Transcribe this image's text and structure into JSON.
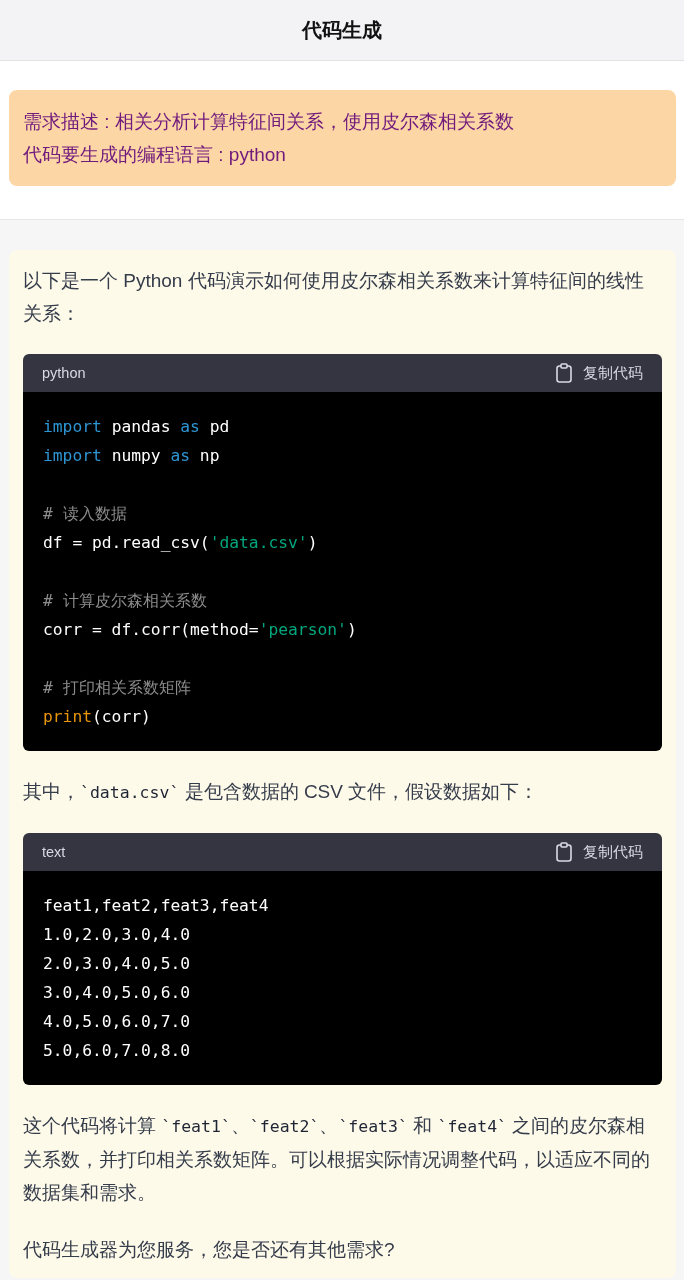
{
  "header": {
    "title": "代码生成"
  },
  "request": {
    "lines": [
      "需求描述 : 相关分析计算特征间关系，使用皮尔森相关系数",
      "代码要生成的编程语言 : python"
    ]
  },
  "answer": {
    "blocks": [
      {
        "kind": "paragraph",
        "parts": [
          {
            "kind": "text",
            "text": "以下是一个 Python 代码演示如何使用皮尔森相关系数来计算特征间的线性关系："
          }
        ]
      },
      {
        "kind": "code",
        "language": "python",
        "copy_label": "复制代码",
        "groups": [
          [
            [
              {
                "kind": "keyword",
                "text": "import"
              },
              {
                "kind": "plain",
                "text": " pandas "
              },
              {
                "kind": "keyword",
                "text": "as"
              },
              {
                "kind": "plain",
                "text": " pd"
              }
            ],
            [
              {
                "kind": "keyword",
                "text": "import"
              },
              {
                "kind": "plain",
                "text": " numpy "
              },
              {
                "kind": "keyword",
                "text": "as"
              },
              {
                "kind": "plain",
                "text": " np"
              }
            ]
          ],
          [
            [
              {
                "kind": "comment",
                "text": "# 读入数据"
              }
            ],
            [
              {
                "kind": "plain",
                "text": "df = pd.read_csv("
              },
              {
                "kind": "string",
                "text": "'data.csv'"
              },
              {
                "kind": "plain",
                "text": ")"
              }
            ]
          ],
          [
            [
              {
                "kind": "comment",
                "text": "# 计算皮尔森相关系数"
              }
            ],
            [
              {
                "kind": "plain",
                "text": "corr = df.corr(method="
              },
              {
                "kind": "string",
                "text": "'pearson'"
              },
              {
                "kind": "plain",
                "text": ")"
              }
            ]
          ],
          [
            [
              {
                "kind": "comment",
                "text": "# 打印相关系数矩阵"
              }
            ],
            [
              {
                "kind": "builtin",
                "text": "print"
              },
              {
                "kind": "plain",
                "text": "(corr)"
              }
            ]
          ]
        ]
      },
      {
        "kind": "paragraph",
        "parts": [
          {
            "kind": "text",
            "text": "其中，"
          },
          {
            "kind": "code",
            "text": "`data.csv`"
          },
          {
            "kind": "text",
            "text": " 是包含数据的 CSV 文件，假设数据如下："
          }
        ]
      },
      {
        "kind": "code",
        "language": "text",
        "copy_label": "复制代码",
        "groups": [
          [
            [
              {
                "kind": "plain",
                "text": "feat1,feat2,feat3,feat4"
              }
            ],
            [
              {
                "kind": "plain",
                "text": "1.0,2.0,3.0,4.0"
              }
            ],
            [
              {
                "kind": "plain",
                "text": "2.0,3.0,4.0,5.0"
              }
            ],
            [
              {
                "kind": "plain",
                "text": "3.0,4.0,5.0,6.0"
              }
            ],
            [
              {
                "kind": "plain",
                "text": "4.0,5.0,6.0,7.0"
              }
            ],
            [
              {
                "kind": "plain",
                "text": "5.0,6.0,7.0,8.0"
              }
            ]
          ]
        ]
      },
      {
        "kind": "paragraph",
        "parts": [
          {
            "kind": "text",
            "text": "这个代码将计算 "
          },
          {
            "kind": "code",
            "text": "`feat1`"
          },
          {
            "kind": "text",
            "text": "、"
          },
          {
            "kind": "code",
            "text": "`feat2`"
          },
          {
            "kind": "text",
            "text": "、"
          },
          {
            "kind": "code",
            "text": "`feat3`"
          },
          {
            "kind": "text",
            "text": " 和 "
          },
          {
            "kind": "code",
            "text": "`feat4`"
          },
          {
            "kind": "text",
            "text": " 之间的皮尔森相关系数，并打印相关系数矩阵。可以根据实际情况调整代码，以适应不同的数据集和需求。"
          }
        ]
      },
      {
        "kind": "paragraph",
        "parts": [
          {
            "kind": "text",
            "text": "代码生成器为您服务，您是否还有其他需求?"
          }
        ]
      }
    ]
  }
}
